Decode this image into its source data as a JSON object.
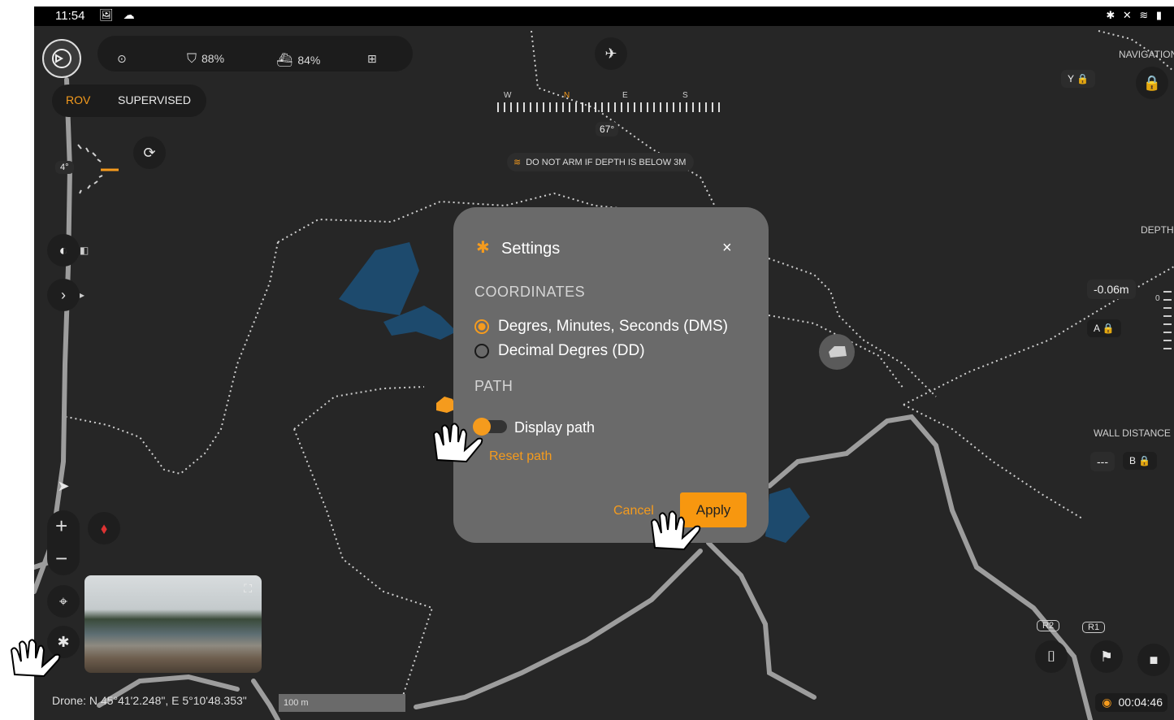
{
  "status_bar": {
    "time": "11:54",
    "left_icons": "🖼 ☁",
    "system_icons": "✱ ✕ ≋ ▮"
  },
  "telemetry": {
    "drone_battery": "88%",
    "boat_battery": "84%"
  },
  "mode_toggle": {
    "rov": "ROV",
    "supervised": "SUPERVISED"
  },
  "compass": {
    "w": "W",
    "n": "N",
    "e": "E",
    "s": "S",
    "heading": "67°"
  },
  "warning": "DO NOT ARM IF DEPTH IS BELOW 3M",
  "pitch_value": "4°",
  "right_panel": {
    "navigation_label": "NAVIGATION",
    "depth_label": "DEPTH",
    "depth_value": "-0.06m",
    "depth_tick": "0",
    "wall_distance_label": "WALL DISTANCE",
    "wall_distance_value": "---",
    "button_y": "Y",
    "button_a": "A",
    "button_b": "B"
  },
  "settings_modal": {
    "title": "Settings",
    "close": "×",
    "coordinates_heading": "COORDINATES",
    "option_dms": "Degres, Minutes, Seconds (DMS)",
    "option_dd": "Decimal Degres (DD)",
    "selected_option": "dms",
    "path_heading": "PATH",
    "display_path_label": "Display path",
    "display_path_on": true,
    "reset_path": "Reset path",
    "cancel": "Cancel",
    "apply": "Apply"
  },
  "map_controls": {
    "zoom_in": "+",
    "zoom_out": "−"
  },
  "scale_label": "100 m",
  "drone_coordinates": "Drone: N 45°41'2.248\", E 5°10'48.353\"",
  "gamepad_buttons": {
    "r2": "R2",
    "r1": "R1"
  },
  "recording_timer": "00:04:46",
  "colors": {
    "accent": "#f59b1d",
    "background": "#262626",
    "modal": "#6a6a6a"
  }
}
